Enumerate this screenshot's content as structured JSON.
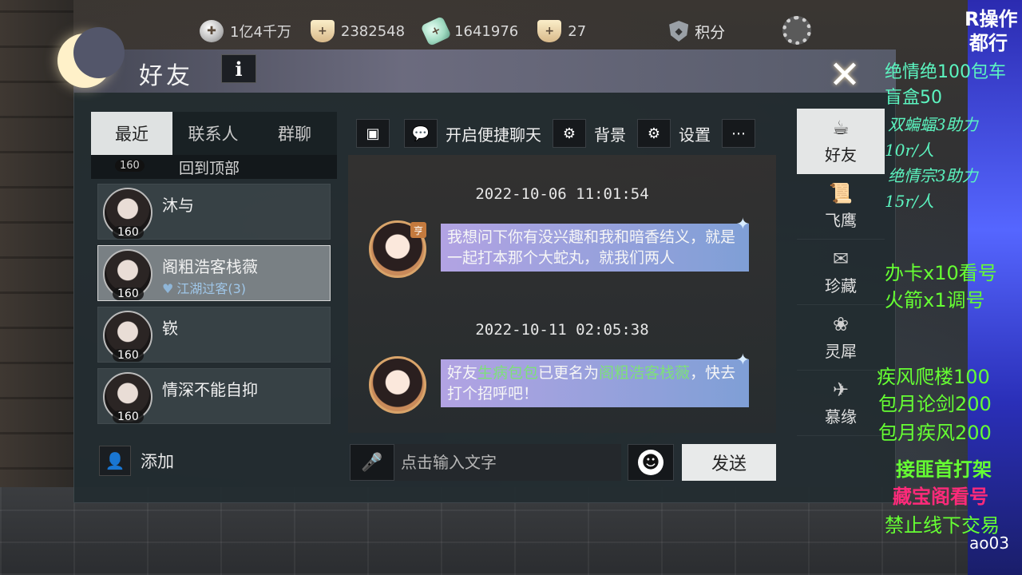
{
  "resources": [
    {
      "icon": "coin-icon",
      "value": "1亿4千万"
    },
    {
      "icon": "silver-icon",
      "value": "2382548"
    },
    {
      "icon": "jade-icon",
      "value": "1641976"
    },
    {
      "icon": "bowl-icon",
      "value": "27"
    }
  ],
  "score_label": "积分",
  "panel": {
    "title": "好友",
    "info_label": "i",
    "close_label": "✕"
  },
  "left_tabs": [
    "最近",
    "联系人",
    "群聊"
  ],
  "back_to_top": {
    "label": "回到顶部",
    "level": "160"
  },
  "friends": [
    {
      "name": "沐与",
      "level": "160",
      "sub": ""
    },
    {
      "name": "阁粗浩客栈薇",
      "level": "160",
      "sub": "江湖过客(3)"
    },
    {
      "name": "嵚",
      "level": "160",
      "sub": ""
    },
    {
      "name": "情深不能自抑",
      "level": "160",
      "sub": ""
    }
  ],
  "add_label": "添加",
  "chat_toolbar": {
    "quick_chat": "开启便捷聊天",
    "background": "背景",
    "settings": "设置"
  },
  "messages": [
    {
      "timestamp": "2022-10-06 11:01:54",
      "badge": "亨",
      "text": "我想问下你有没兴趣和我和暗香结义，就是一起打本那个大蛇丸，就我们两人"
    },
    {
      "timestamp": "2022-10-11 02:05:38",
      "text_before": "好友",
      "highlight1": "生病包包",
      "text_mid": "已更名为",
      "highlight2": "阁粗浩客栈薇",
      "text_after": "，快去打个招呼吧！"
    }
  ],
  "input": {
    "placeholder": "点击输入文字"
  },
  "send_label": "发送",
  "right_nav": [
    {
      "icon": "teapot-icon",
      "label": "好友"
    },
    {
      "icon": "scroll-icon",
      "label": "飞鹰"
    },
    {
      "icon": "collection-icon",
      "label": "珍藏"
    },
    {
      "icon": "charm-icon",
      "label": "灵犀"
    },
    {
      "icon": "crane-icon",
      "label": "慕缘"
    }
  ],
  "overlay": {
    "top1": "R操作",
    "top2": "都行",
    "line1": "绝情绝100包车",
    "line2": "盲盒50",
    "line3": "双蝙蝠3助力",
    "line4": "10r/人",
    "line5": "绝情宗3助力",
    "line6": "15r/人",
    "line7": "办卡x10看号",
    "line8": "火箭x1调号",
    "line9": "疾风爬楼100",
    "line10": "包月论剑200",
    "line11": "包月疾风200",
    "line12": "接匪首打架",
    "line13": "藏宝阁看号",
    "line14": "禁止线下交易",
    "line15": "ao03"
  },
  "colors": {
    "overlay_cyan": "#5cf5c0",
    "overlay_green": "#66ff33",
    "overlay_pink": "#ff2a7a",
    "bubble_start": "#b2a3e3",
    "bubble_end": "#7f9fd6",
    "highlight_green": "#7ee07a"
  }
}
